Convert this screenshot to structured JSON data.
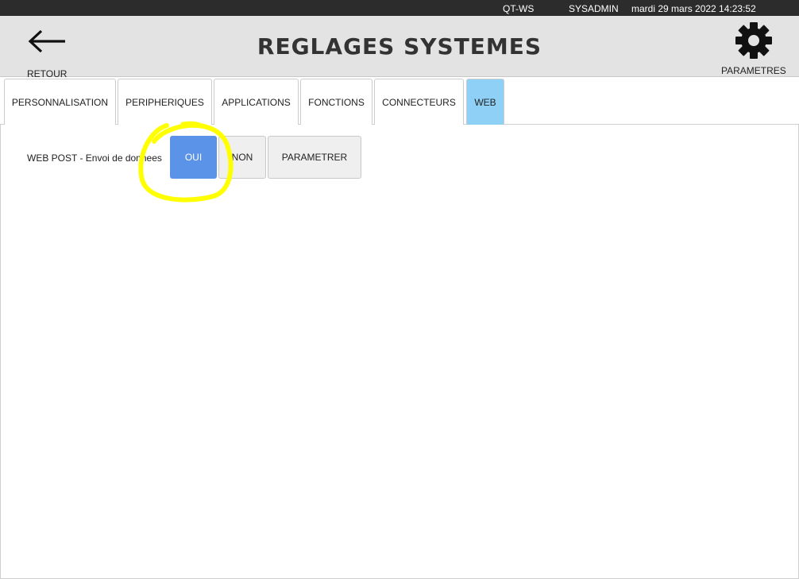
{
  "topbar": {
    "station": "QT-WS",
    "user": "SYSADMIN",
    "datetime": "mardi 29 mars 2022  14:23:52"
  },
  "header": {
    "back_label": "RETOUR",
    "back_icon": "arrow-left-icon",
    "title": "REGLAGES SYSTEMES",
    "settings_label": "PARAMETRES",
    "settings_icon": "gear-icon"
  },
  "tabs": [
    {
      "label": "PERSONNALISATION",
      "active": false
    },
    {
      "label": "PERIPHERIQUES",
      "active": false
    },
    {
      "label": "APPLICATIONS",
      "active": false
    },
    {
      "label": "FONCTIONS",
      "active": false
    },
    {
      "label": "CONNECTEURS",
      "active": false
    },
    {
      "label": "WEB",
      "active": true
    }
  ],
  "web_post": {
    "label": "WEB POST - Envoi de donnees",
    "yes_label": "OUI",
    "no_label": "NON",
    "configure_label": "PARAMETRER",
    "selected": "OUI"
  },
  "colors": {
    "topbar_bg": "#2c2c2c",
    "header_bg": "#e3e3e3",
    "active_tab": "#8fd0f6",
    "selected_button": "#5b93e8",
    "highlight_annotation": "#ffff00"
  }
}
